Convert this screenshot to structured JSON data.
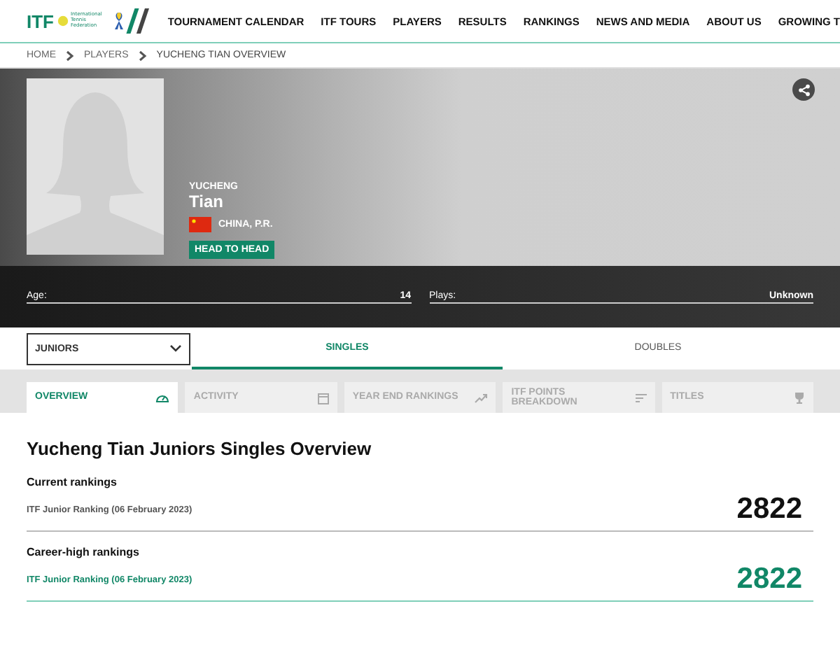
{
  "logo": {
    "text": "ITF",
    "caption": "International Tennis Federation"
  },
  "nav": [
    "TOURNAMENT CALENDAR",
    "ITF TOURS",
    "PLAYERS",
    "RESULTS",
    "RANKINGS",
    "NEWS AND MEDIA",
    "ABOUT US",
    "GROWING T"
  ],
  "breadcrumbs": [
    "HOME",
    "PLAYERS",
    "YUCHENG TIAN OVERVIEW"
  ],
  "player": {
    "first_name": "YUCHENG",
    "last_name": "Tian",
    "country": "CHINA, P.R.",
    "head_to_head": "HEAD TO HEAD"
  },
  "stats": [
    {
      "label": "Age:",
      "value": "14"
    },
    {
      "label": "Plays:",
      "value": "Unknown"
    }
  ],
  "circuit_select": {
    "value": "JUNIORS"
  },
  "event_tabs": [
    {
      "label": "SINGLES",
      "selected": true
    },
    {
      "label": "DOUBLES",
      "selected": false
    }
  ],
  "section_tabs": [
    {
      "label": "OVERVIEW",
      "kind": "gauge",
      "selected": true
    },
    {
      "label": "ACTIVITY",
      "kind": "calendar",
      "selected": false
    },
    {
      "label": "YEAR END RANKINGS",
      "kind": "trend",
      "selected": false
    },
    {
      "label": "ITF POINTS BREAKDOWN",
      "kind": "bars",
      "selected": false
    },
    {
      "label": "TITLES",
      "kind": "trophy",
      "selected": false
    }
  ],
  "overview": {
    "title": "Yucheng Tian Juniors Singles Overview",
    "rankings": [
      {
        "kind": "current",
        "heading": "Current rankings",
        "label": "ITF Junior Ranking (06 February 2023)",
        "rank": "2822"
      },
      {
        "kind": "career-high",
        "heading": "Career-high rankings",
        "label": "ITF Junior Ranking (06 February 2023)",
        "rank": "2822"
      }
    ]
  }
}
